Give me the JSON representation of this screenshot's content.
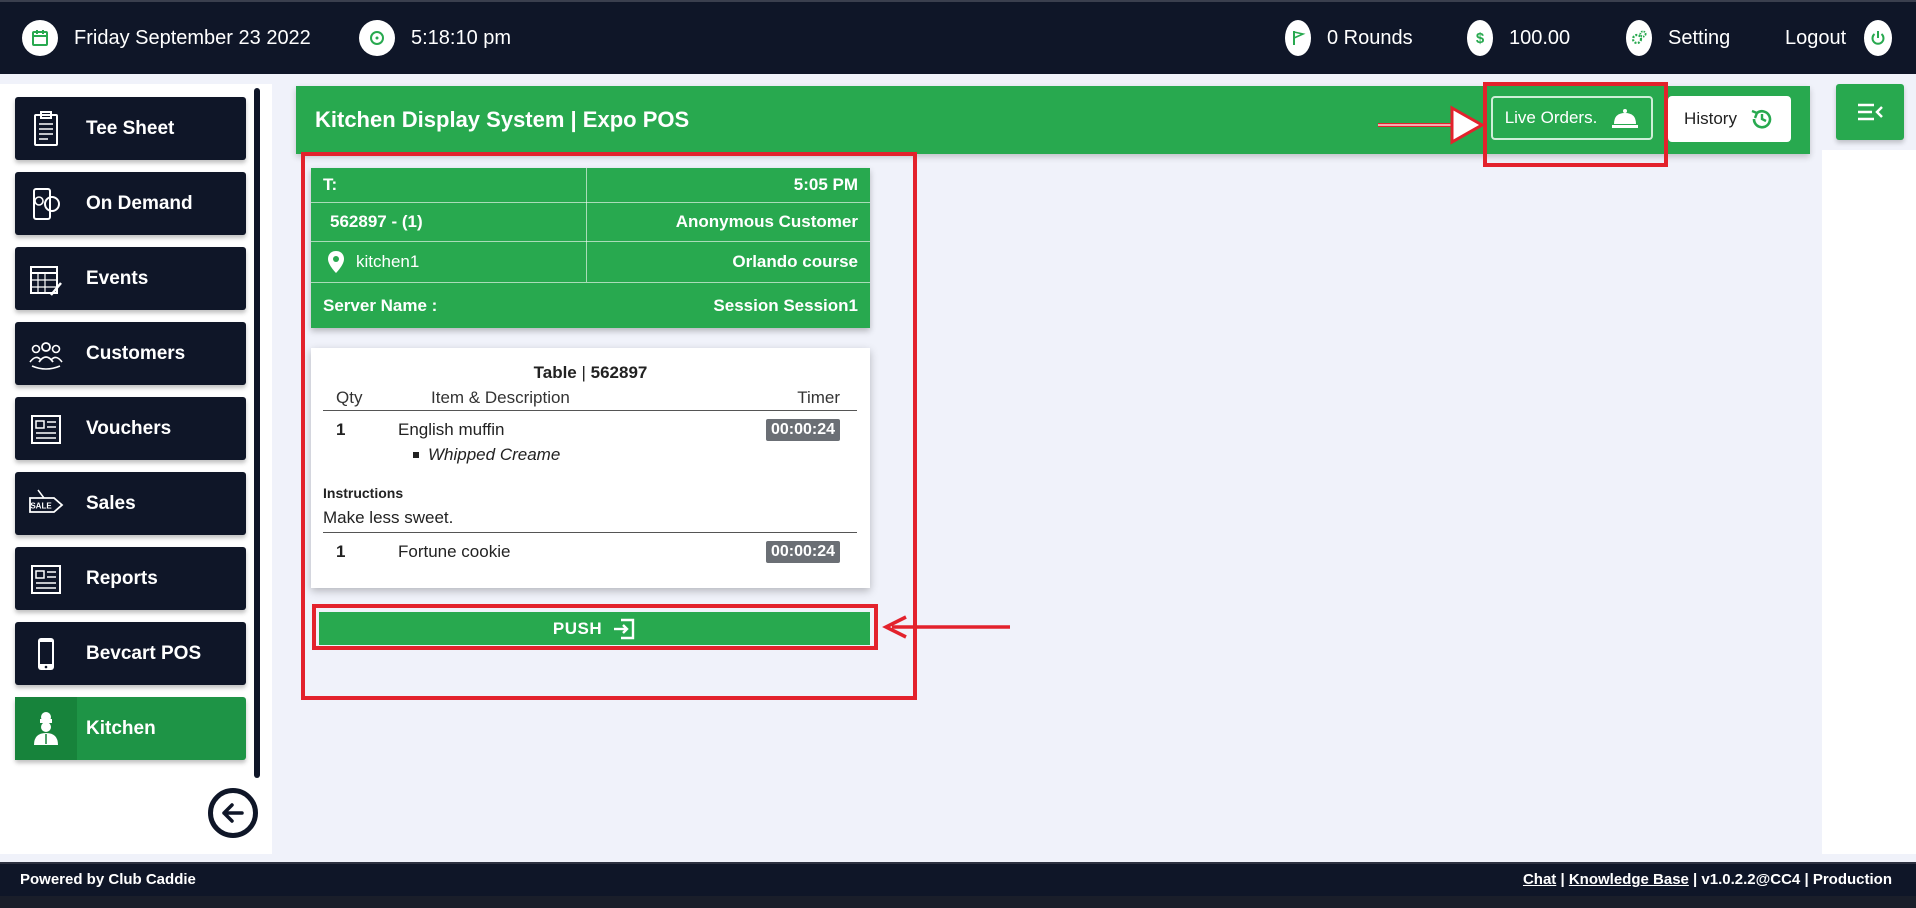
{
  "topbar": {
    "date": "Friday September 23 2022",
    "time": "5:18:10 pm",
    "rounds": "0 Rounds",
    "balance": "100.00",
    "setting": "Setting",
    "logout": "Logout"
  },
  "sidebar": {
    "items": [
      {
        "label": "Tee Sheet",
        "icon": "clipboard-icon"
      },
      {
        "label": "On Demand",
        "icon": "phone-golf-icon"
      },
      {
        "label": "Events",
        "icon": "calendar-edit-icon"
      },
      {
        "label": "Customers",
        "icon": "people-icon"
      },
      {
        "label": "Vouchers",
        "icon": "newspaper-icon"
      },
      {
        "label": "Sales",
        "icon": "sale-tag-icon"
      },
      {
        "label": "Reports",
        "icon": "report-icon"
      },
      {
        "label": "Bevcart POS",
        "icon": "mobile-icon"
      },
      {
        "label": "Kitchen",
        "icon": "chef-icon",
        "active": true
      }
    ]
  },
  "header": {
    "title": "Kitchen Display System | Expo POS",
    "live_orders": "Live Orders.",
    "history": "History"
  },
  "order": {
    "t_label": "T:",
    "time": "5:05 PM",
    "order_id": "562897 - (1)",
    "customer": "Anonymous Customer",
    "location": "kitchen1",
    "course": "Orlando course",
    "server_label": "Server Name :",
    "session": "Session Session1",
    "table_label": "Table",
    "table_number": "562897",
    "col_qty": "Qty",
    "col_item": "Item & Description",
    "col_timer": "Timer",
    "items": [
      {
        "qty": "1",
        "name": "English muffin",
        "modifier": "Whipped Creame",
        "timer": "00:00:24"
      },
      {
        "qty": "1",
        "name": "Fortune cookie",
        "timer": "00:00:24"
      }
    ],
    "instructions_label": "Instructions",
    "instructions": "Make less sweet.",
    "push_label": "PUSH"
  },
  "footer": {
    "powered": "Powered by Club Caddie",
    "chat": "Chat",
    "kb": "Knowledge Base",
    "version": "v1.0.2.2@CC4",
    "env": "Production"
  },
  "colors": {
    "dark": "#0f1628",
    "green": "#28a94f",
    "annotation_red": "#e3222c"
  }
}
